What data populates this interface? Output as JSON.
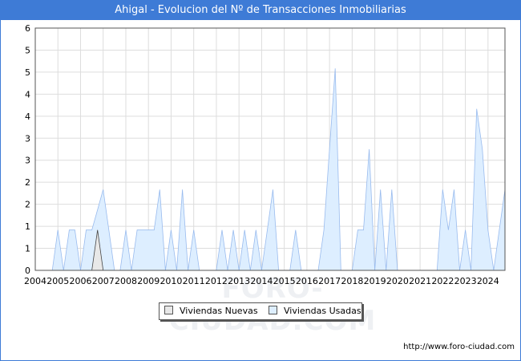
{
  "title": "Ahigal - Evolucion del Nº de Transacciones Inmobiliarias",
  "source_url": "http://www.foro-ciudad.com",
  "watermark": "FORO-CIUDAD.COM",
  "colors": {
    "title_bg": "#3e7bd6",
    "nuevas_fill": "#e8e8e8",
    "usadas_fill": "#ddeeff",
    "usadas_line": "#99bbee"
  },
  "chart_data": {
    "type": "area",
    "title": "Ahigal - Evolucion del Nº de Transacciones Inmobiliarias",
    "xlabel": "",
    "ylabel": "",
    "ylim": [
      0,
      6
    ],
    "xlim": [
      2004,
      2024.75
    ],
    "y_ticks": [
      "0",
      "1",
      "1",
      "2",
      "2",
      "3",
      "3",
      "4",
      "4",
      "5",
      "5",
      "6"
    ],
    "x_ticks": [
      "2004",
      "2005",
      "2006",
      "2007",
      "2008",
      "2009",
      "2010",
      "2011",
      "2012",
      "2013",
      "2014",
      "2015",
      "2016",
      "2017",
      "2018",
      "2019",
      "2020",
      "2021",
      "2022",
      "2023",
      "2024"
    ],
    "grid": true,
    "legend_position": "bottom-center",
    "series": [
      {
        "name": "Viviendas Nuevas",
        "color": "#e8e8e8",
        "points": [
          [
            2006.5,
            0
          ],
          [
            2006.75,
            1
          ],
          [
            2007.0,
            0
          ]
        ]
      },
      {
        "name": "Viviendas Usadas",
        "color": "#ddeeff",
        "points": [
          [
            2004.75,
            0
          ],
          [
            2005.0,
            1
          ],
          [
            2005.25,
            0
          ],
          [
            2005.5,
            1
          ],
          [
            2005.75,
            1
          ],
          [
            2006.0,
            0
          ],
          [
            2006.25,
            1
          ],
          [
            2006.5,
            1
          ],
          [
            2006.75,
            1.5
          ],
          [
            2007.0,
            2
          ],
          [
            2007.25,
            1
          ],
          [
            2007.5,
            0
          ],
          [
            2007.75,
            0
          ],
          [
            2008.0,
            1
          ],
          [
            2008.25,
            0
          ],
          [
            2008.5,
            1
          ],
          [
            2008.75,
            1
          ],
          [
            2009.0,
            1
          ],
          [
            2009.25,
            1
          ],
          [
            2009.5,
            2
          ],
          [
            2009.75,
            0
          ],
          [
            2010.0,
            1
          ],
          [
            2010.25,
            0
          ],
          [
            2010.5,
            2
          ],
          [
            2010.75,
            0
          ],
          [
            2011.0,
            1
          ],
          [
            2011.25,
            0
          ],
          [
            2011.5,
            0
          ],
          [
            2011.75,
            0
          ],
          [
            2012.0,
            0
          ],
          [
            2012.25,
            1
          ],
          [
            2012.5,
            0
          ],
          [
            2012.75,
            1
          ],
          [
            2013.0,
            0
          ],
          [
            2013.25,
            1
          ],
          [
            2013.5,
            0
          ],
          [
            2013.75,
            1
          ],
          [
            2014.0,
            0
          ],
          [
            2014.25,
            1
          ],
          [
            2014.5,
            2
          ],
          [
            2014.75,
            0
          ],
          [
            2015.0,
            0
          ],
          [
            2015.25,
            0
          ],
          [
            2015.5,
            1
          ],
          [
            2015.75,
            0
          ],
          [
            2016.0,
            0
          ],
          [
            2016.25,
            0
          ],
          [
            2016.5,
            0
          ],
          [
            2016.75,
            1
          ],
          [
            2017.0,
            3
          ],
          [
            2017.25,
            5
          ],
          [
            2017.5,
            0
          ],
          [
            2017.75,
            0
          ],
          [
            2018.0,
            0
          ],
          [
            2018.25,
            1
          ],
          [
            2018.5,
            1
          ],
          [
            2018.75,
            3
          ],
          [
            2019.0,
            0
          ],
          [
            2019.25,
            2
          ],
          [
            2019.5,
            0
          ],
          [
            2019.75,
            2
          ],
          [
            2020.0,
            0
          ],
          [
            2020.25,
            0
          ],
          [
            2020.5,
            0
          ],
          [
            2020.75,
            0
          ],
          [
            2021.0,
            0
          ],
          [
            2021.25,
            0
          ],
          [
            2021.5,
            0
          ],
          [
            2021.75,
            0
          ],
          [
            2022.0,
            2
          ],
          [
            2022.25,
            1
          ],
          [
            2022.5,
            2
          ],
          [
            2022.75,
            0
          ],
          [
            2023.0,
            1
          ],
          [
            2023.25,
            0
          ],
          [
            2023.5,
            4
          ],
          [
            2023.75,
            3
          ],
          [
            2024.0,
            1
          ],
          [
            2024.25,
            0
          ],
          [
            2024.5,
            1
          ],
          [
            2024.75,
            2
          ],
          [
            2025.0,
            1
          ]
        ]
      }
    ]
  }
}
